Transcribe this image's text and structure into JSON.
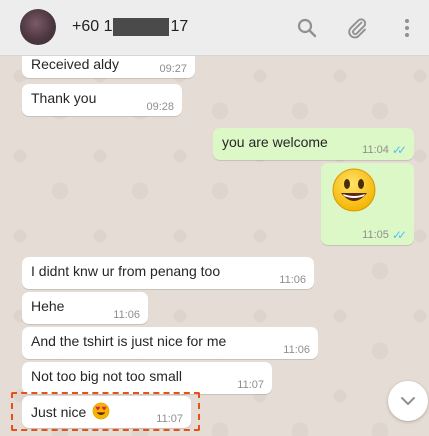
{
  "header": {
    "name_prefix": "+60 1",
    "name_suffix": "17",
    "icons": [
      "search-icon",
      "attach-icon",
      "menu-icon"
    ]
  },
  "messages": [
    {
      "dir": "in",
      "text": "Received aldy",
      "time": "09:27"
    },
    {
      "dir": "in",
      "text": "Thank you",
      "time": "09:28"
    },
    {
      "dir": "out",
      "text": "you are welcome",
      "time": "11:04",
      "status": "read"
    },
    {
      "dir": "out",
      "emoji": "grinning-face",
      "time": "11:05",
      "status": "read"
    },
    {
      "dir": "in",
      "text": "I didnt knw ur from penang too",
      "time": "11:06"
    },
    {
      "dir": "in",
      "text": "Hehe",
      "time": "11:06"
    },
    {
      "dir": "in",
      "text": "And the tshirt is just nice for me",
      "time": "11:06"
    },
    {
      "dir": "in",
      "text": "Not too big not too small",
      "time": "11:07"
    },
    {
      "dir": "in",
      "text": "Just nice",
      "emoji": "heart-eyes",
      "time": "11:07",
      "highlighted": true
    }
  ],
  "colors": {
    "chat_bg": "#e5ddd5",
    "incoming": "#ffffff",
    "outgoing": "#dcf8c6",
    "read_ticks": "#4fc3f7",
    "highlight": "#e8501a"
  }
}
